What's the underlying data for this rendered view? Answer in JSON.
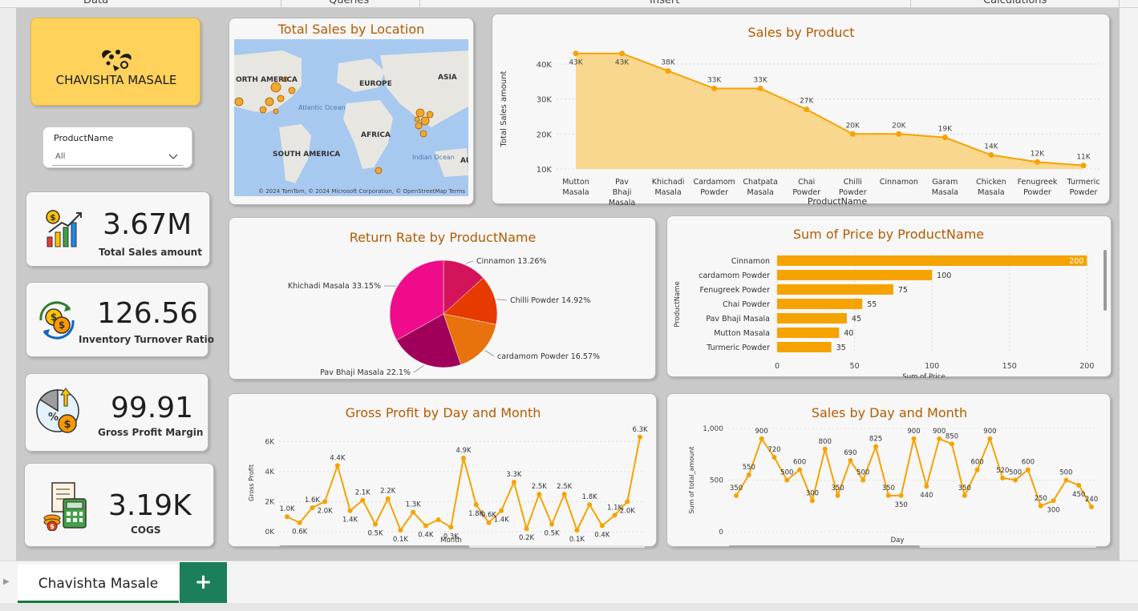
{
  "ribbon": {
    "tabs": [
      "Data",
      "Queries",
      "Insert",
      "Calculations"
    ]
  },
  "brand": {
    "name": "CHAVISHTA MASALE"
  },
  "slicer": {
    "label": "ProductName",
    "value": "All"
  },
  "kpis": [
    {
      "value": "3.67M",
      "label": "Total Sales amount"
    },
    {
      "value": "126.56",
      "label": "Inventory Turnover Ratio"
    },
    {
      "value": "99.91",
      "label": "Gross Profit Margin"
    },
    {
      "value": "3.19K",
      "label": "COGS"
    }
  ],
  "map": {
    "title": "Total Sales by Location",
    "labels": [
      "ORTH AMERICA",
      "EUROPE",
      "ASIA",
      "Atlantic Ocean",
      "AFRICA",
      "SOUTH AMERICA",
      "Indian Ocean",
      "AU"
    ],
    "attribution": "© 2024 TomTom, © 2024 Microsoft Corporation, © OpenStreetMap  Terms"
  },
  "colors": {
    "accent": "#f5a300",
    "title": "#b35b00",
    "area": "#f9d383"
  },
  "chart_data": [
    {
      "id": "sales-by-product",
      "type": "area",
      "title": "Sales by Product",
      "xlabel": "ProductName",
      "ylabel": "Total Sales amount",
      "categories": [
        "Mutton Masala",
        "Pav Bhaji Masala",
        "Khichadi Masala",
        "Cardamom Powder",
        "Chatpata Masala",
        "Chai Powder",
        "Chilli Powder",
        "Cinnamon",
        "Garam Masala",
        "Chicken Masala",
        "Fenugreek Powder",
        "Turmeric Powder"
      ],
      "values": [
        43,
        43,
        38,
        33,
        33,
        27,
        20,
        20,
        19,
        14,
        12,
        11
      ],
      "data_labels": [
        "43K",
        "43K",
        "38K",
        "33K",
        "33K",
        "27K",
        "20K",
        "20K",
        "19K",
        "14K",
        "12K",
        "11K"
      ],
      "yticks": [
        "10K",
        "20K",
        "30K",
        "40K"
      ],
      "ylim": [
        10,
        45
      ]
    },
    {
      "id": "return-rate",
      "type": "pie",
      "title": "Return Rate by ProductName",
      "slices": [
        {
          "label": "Cinnamon 13.26%",
          "value": 13.26,
          "color": "#d4145a"
        },
        {
          "label": "Chilli Powder 14.92%",
          "value": 14.92,
          "color": "#e63a00"
        },
        {
          "label": "cardamom Powder 16.57%",
          "value": 16.57,
          "color": "#e8720c"
        },
        {
          "label": "Pav Bhaji Masala 22.1%",
          "value": 22.1,
          "color": "#a0005a"
        },
        {
          "label": "Khichadi Masala 33.15%",
          "value": 33.15,
          "color": "#ee0c8a"
        }
      ]
    },
    {
      "id": "sum-of-price",
      "type": "bar",
      "orientation": "horizontal",
      "title": "Sum of Price by ProductName",
      "xlabel": "Sum of Price",
      "ylabel": "ProductName",
      "categories": [
        "Cinnamon",
        "cardamom Powder",
        "Fenugreek Powder",
        "Chai Powder",
        "Pav Bhaji Masala",
        "Mutton Masala",
        "Turmeric Powder"
      ],
      "values": [
        200,
        100,
        75,
        55,
        45,
        40,
        35
      ],
      "data_labels": [
        "200",
        "100",
        "75",
        "55",
        "45",
        "40",
        "35"
      ],
      "xticks": [
        "0",
        "50",
        "100",
        "150",
        "200"
      ],
      "xlim": [
        0,
        205
      ]
    },
    {
      "id": "gross-profit",
      "type": "line",
      "title": "Gross Profit by Day and Month",
      "xlabel": "Month",
      "ylabel": "Gross Profit",
      "values": [
        1.0,
        0.6,
        1.6,
        2.0,
        4.4,
        1.4,
        2.1,
        0.5,
        2.2,
        0.1,
        1.3,
        0.4,
        0.8,
        0.3,
        4.9,
        1.8,
        0.6,
        1.4,
        3.3,
        0.2,
        2.5,
        0.5,
        2.5,
        0.1,
        1.8,
        0.4,
        1.1,
        2.0,
        6.3
      ],
      "data_labels": [
        "1.0K",
        "0.6K",
        "1.6K",
        "2.0K",
        "4.4K",
        "1.4K",
        "2.1K",
        "0.5K",
        "2.2K",
        "0.1K",
        "1.3K",
        "0.4K",
        "",
        "0.3K",
        "4.9K",
        "1.8K",
        "0.6K",
        "1.4K",
        "3.3K",
        "0.2K",
        "2.5K",
        "0.5K",
        "2.5K",
        "0.1K",
        "1.8K",
        "0.4K",
        "1.1K",
        "2.0K",
        "6.3K"
      ],
      "yticks": [
        "0K",
        "2K",
        "4K",
        "6K"
      ],
      "ylim": [
        0,
        6.5
      ]
    },
    {
      "id": "sales-by-day",
      "type": "line",
      "title": "Sales by Day and Month",
      "xlabel": "Day",
      "ylabel": "Sum of total_amount",
      "values": [
        350,
        550,
        900,
        720,
        500,
        600,
        300,
        800,
        350,
        690,
        500,
        825,
        350,
        350,
        900,
        440,
        900,
        850,
        350,
        600,
        900,
        520,
        500,
        600,
        250,
        300,
        500,
        450,
        240
      ],
      "data_labels": [
        "350",
        "550",
        "900",
        "720",
        "500",
        "600",
        "300",
        "800",
        "350",
        "690",
        "500",
        "825",
        "350",
        "350",
        "900",
        "440",
        "900",
        "850",
        "350",
        "600",
        "900",
        "520",
        "500",
        "600",
        "250",
        "300",
        "500",
        "450",
        "240"
      ],
      "yticks": [
        "0",
        "500",
        "1,000"
      ],
      "ylim": [
        0,
        1000
      ]
    }
  ],
  "sheet_tab": {
    "label": "Chavishta Masale",
    "add": "+"
  }
}
